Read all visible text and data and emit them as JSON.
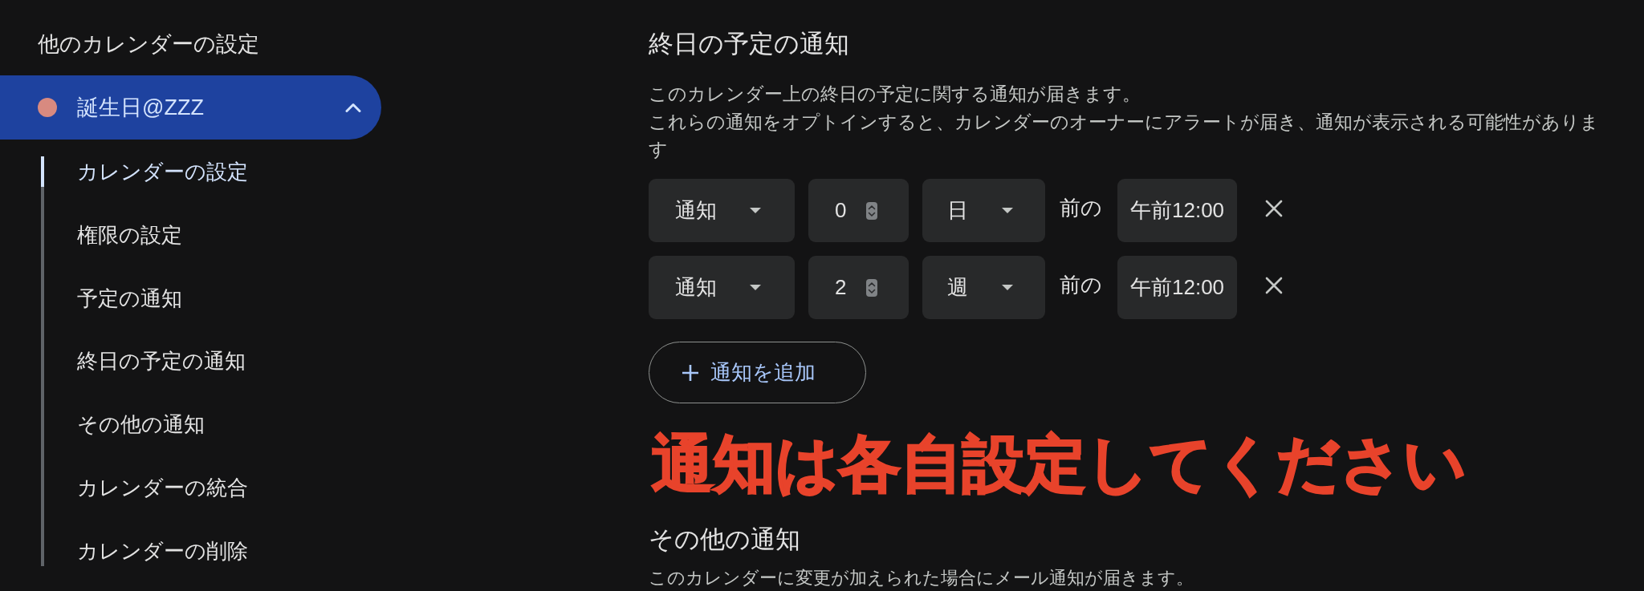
{
  "sidebar": {
    "title": "他のカレンダーの設定",
    "calendars": [
      {
        "name": "誕生日@ZZZ",
        "color": "#d88a80",
        "selected": true,
        "expanded": true,
        "sections": [
          {
            "label": "カレンダーの設定",
            "selected": true
          },
          {
            "label": "権限の設定",
            "selected": false
          },
          {
            "label": "予定の通知",
            "selected": false
          },
          {
            "label": "終日の予定の通知",
            "selected": false
          },
          {
            "label": "その他の通知",
            "selected": false
          },
          {
            "label": "カレンダーの統合",
            "selected": false
          },
          {
            "label": "カレンダーの削除",
            "selected": false
          }
        ]
      }
    ]
  },
  "all_day_section": {
    "title": "終日の予定の通知",
    "description": [
      "このカレンダー上の終日の予定に関する通知が届きます。",
      "これらの通知をオプトインすると、カレンダーのオーナーにアラートが届き、通知が表示される可能性があります"
    ],
    "notifications": [
      {
        "method": "通知",
        "amount": "0",
        "unit": "日",
        "connector": "前の",
        "time": "午前12:00"
      },
      {
        "method": "通知",
        "amount": "2",
        "unit": "週",
        "connector": "前の",
        "time": "午前12:00"
      }
    ],
    "add_button": "通知を追加"
  },
  "annotation": "通知は各自設定してください",
  "other_section": {
    "title": "その他の通知",
    "description": "このカレンダーに変更が加えられた場合にメール通知が届きます。"
  }
}
